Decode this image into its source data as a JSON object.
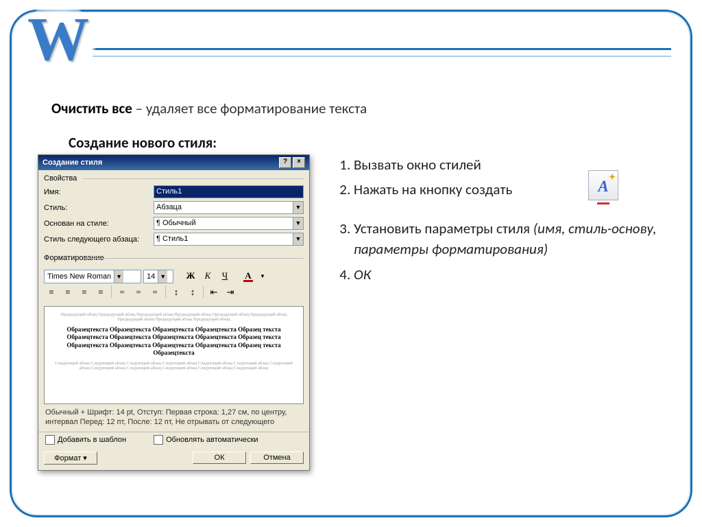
{
  "logo_letter": "W",
  "intro": {
    "bold": "Очистить все",
    "rest": " – удаляет все форматирование текста"
  },
  "section_title": "Создание нового стиля:",
  "instructions": [
    {
      "text": "Вызвать окно стилей",
      "italic": false
    },
    {
      "text": "Нажать на кнопку создать",
      "italic": false
    },
    {
      "text": "Установить параметры стиля ",
      "italic_extra": "(имя, стиль-основу, параметры форматирования)",
      "italic": false
    },
    {
      "text": "ОК",
      "italic": true
    }
  ],
  "dialog": {
    "title": "Создание стиля",
    "help_btn": "?",
    "close_btn": "×",
    "group_props": "Свойства",
    "rows": {
      "name_label": "Имя:",
      "name_value": "Стиль1",
      "style_label": "Стиль:",
      "style_value": "Абзаца",
      "based_label": "Основан на стиле:",
      "based_value": "Обычный",
      "next_label": "Стиль следующего абзаца:",
      "next_value": "Стиль1"
    },
    "group_fmt": "Форматирование",
    "font_name": "Times New Roman",
    "font_size": "14",
    "bold": "Ж",
    "italic": "К",
    "underline": "Ч",
    "preview_grey_top": "Предыдущий абзац Предыдущий абзац Предыдущий абзац Предыдущий абзац Предыдущий абзац Предыдущий абзац Предыдущий абзац Предыдущий абзац Предыдущий абзац",
    "preview_sample": "Образецтекста Образецтекста Образецтекста Образецтекста Образец текста Образецтекста Образецтекста Образецтекста Образецтекста Образец текста Образецтекста Образецтекста Образецтекста Образецтекста Образец текста Образецтекста",
    "preview_grey_bot": "Следующий абзац Следующий абзац Следующий абзац Следующий абзац Следующий абзац Следующий абзац Следующий абзац Следующий абзац Следующий абзац Следующий абзац Следующий абзац Следующий абзац",
    "summary": "Обычный + Шрифт: 14 pt, Отступ: Первая строка: 1,27 см, по центру, интервал Перед: 12 пт, После: 12 пт, Не отрывать от следующего",
    "chk_template": "Добавить в шаблон",
    "chk_auto": "Обновлять автоматически",
    "btn_format": "Формат",
    "btn_ok": "ОК",
    "btn_cancel": "Отмена"
  }
}
